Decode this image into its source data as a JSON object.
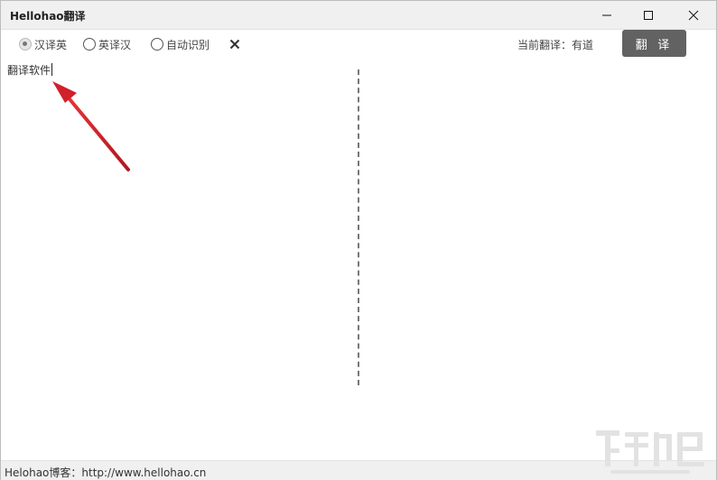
{
  "window": {
    "title": "Hellohao翻译"
  },
  "toolbar": {
    "modes": [
      {
        "label": "汉译英",
        "checked": true
      },
      {
        "label": "英译汉",
        "checked": false
      },
      {
        "label": "自动识别",
        "checked": false
      }
    ],
    "current_label": "当前翻译：有道",
    "translate_label": "翻 译"
  },
  "input": {
    "text": "翻译软件"
  },
  "output": {
    "text": ""
  },
  "status": {
    "text": "Helohao博客：http://www.hellohao.cn"
  },
  "icons": {
    "minimize": "minimize-icon",
    "maximize": "maximize-icon",
    "close": "close-icon",
    "clear": "clear-x-icon"
  },
  "colors": {
    "button_bg": "#626262",
    "arrow": "#d0202a",
    "divider": "#777777"
  }
}
